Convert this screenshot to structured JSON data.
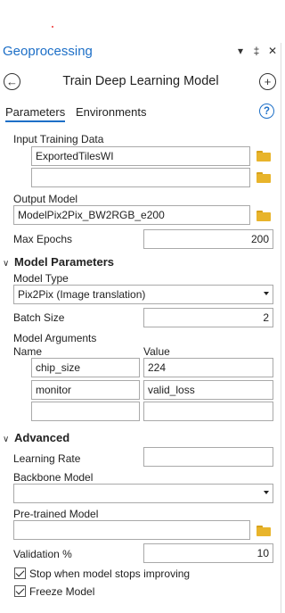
{
  "pane": {
    "title": "Geoprocessing",
    "controls": {
      "dropdown": "▾",
      "pin": "‡",
      "close": "✕"
    }
  },
  "tool": {
    "title": "Train Deep Learning Model",
    "back_icon": "back-arrow-icon",
    "add_icon": "add-icon"
  },
  "tabs": {
    "parameters": "Parameters",
    "environments": "Environments",
    "help": "?"
  },
  "params": {
    "input_training_data_label": "Input Training Data",
    "input_training_data": [
      "ExportedTilesWI",
      ""
    ],
    "output_model_label": "Output Model",
    "output_model": "ModelPix2Pix_BW2RGB_e200",
    "max_epochs_label": "Max Epochs",
    "max_epochs": "200"
  },
  "model_parameters": {
    "section": "Model Parameters",
    "model_type_label": "Model Type",
    "model_type": "Pix2Pix (Image translation)",
    "batch_size_label": "Batch Size",
    "batch_size": "2",
    "model_arguments_label": "Model Arguments",
    "name_header": "Name",
    "value_header": "Value",
    "arguments": [
      {
        "name": "chip_size",
        "value": "224"
      },
      {
        "name": "monitor",
        "value": "valid_loss"
      },
      {
        "name": "",
        "value": ""
      }
    ]
  },
  "advanced": {
    "section": "Advanced",
    "learning_rate_label": "Learning Rate",
    "learning_rate": "",
    "backbone_model_label": "Backbone Model",
    "backbone_model": "",
    "pretrained_model_label": "Pre-trained Model",
    "pretrained_model": "",
    "validation_label": "Validation %",
    "validation": "10",
    "stop_label": "Stop when model stops improving",
    "stop_checked": true,
    "freeze_label": "Freeze Model",
    "freeze_checked": true
  },
  "colors": {
    "accent": "#1d6fc7",
    "folder": "#e8b42b"
  }
}
